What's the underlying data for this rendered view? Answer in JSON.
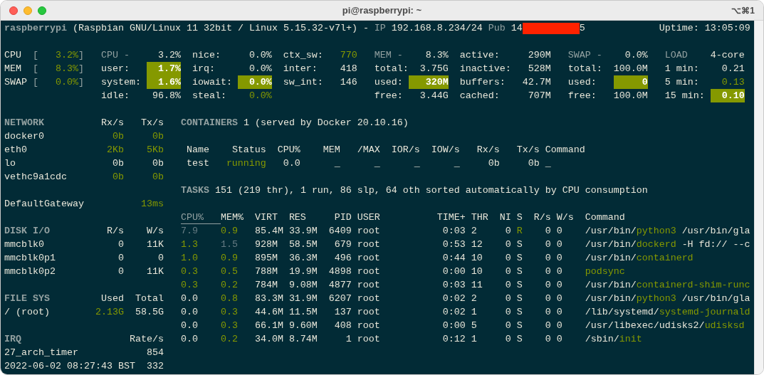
{
  "window": {
    "title": "pi@raspberrypi: ~",
    "shortcut": "⌥⌘1"
  },
  "header": {
    "hostname": "raspberrypi",
    "system": "(Raspbian GNU/Linux 11 32bit / Linux 5.15.32-v7l+)",
    "separator": "-",
    "ip_label": "IP",
    "ip": "192.168.8.234/24",
    "pub_label": "Pub",
    "pub_ip_start": "14",
    "pub_ip_end": "5",
    "uptime": "Uptime: 13:05:09"
  },
  "quicklook": [
    {
      "label": "CPU",
      "open": "[",
      "value": "3.2%",
      "close": "]"
    },
    {
      "label": "MEM",
      "open": "[",
      "value": "8.3%",
      "close": "]"
    },
    {
      "label": "SWAP",
      "open": "[",
      "value": "0.0%",
      "close": "]"
    }
  ],
  "stats": [
    {
      "kind": "cpu",
      "rows": [
        {
          "label": "CPU -",
          "value": "3.2%",
          "kind": "title"
        },
        {
          "label": "user:",
          "value": "1.7%",
          "kind": "warning"
        },
        {
          "label": "system:",
          "value": "1.6%",
          "kind": "warning"
        },
        {
          "label": "idle:",
          "value": "96.8%",
          "kind": "normal"
        }
      ]
    },
    {
      "kind": "cpu_detail",
      "rows": [
        {
          "label": "nice:",
          "value": "0.0%",
          "kind": "normal"
        },
        {
          "label": "irq:",
          "value": "0.0%",
          "kind": "normal"
        },
        {
          "label": "iowait:",
          "value": "0.0%",
          "kind": "warning"
        },
        {
          "label": "steal:",
          "value": "0.0%",
          "kind": "careful"
        }
      ]
    },
    {
      "kind": "cpu_switch",
      "rows": [
        {
          "label": "ctx_sw:",
          "value": "770",
          "kind": "careful"
        },
        {
          "label": "inter:",
          "value": "418",
          "kind": "normal"
        },
        {
          "label": "sw_int:",
          "value": "146",
          "kind": "normal"
        }
      ]
    },
    {
      "kind": "mem",
      "rows": [
        {
          "label": "MEM -",
          "value": "8.3%",
          "kind": "title"
        },
        {
          "label": "total:",
          "value": "3.75G",
          "kind": "normal"
        },
        {
          "label": "used:",
          "value": "320M",
          "kind": "warning"
        },
        {
          "label": "free:",
          "value": "3.44G",
          "kind": "normal"
        }
      ]
    },
    {
      "kind": "mem_detail",
      "rows": [
        {
          "label": "active:",
          "value": "290M",
          "kind": "normal"
        },
        {
          "label": "inactive:",
          "value": "528M",
          "kind": "normal"
        },
        {
          "label": "buffers:",
          "value": "42.7M",
          "kind": "normal"
        },
        {
          "label": "cached:",
          "value": "707M",
          "kind": "normal"
        }
      ]
    },
    {
      "kind": "swap",
      "rows": [
        {
          "label": "SWAP -",
          "value": "0.0%",
          "kind": "title"
        },
        {
          "label": "total:",
          "value": "100.0M",
          "kind": "normal"
        },
        {
          "label": "used:",
          "value": "0",
          "kind": "warning"
        },
        {
          "label": "free:",
          "value": "100.0M",
          "kind": "normal"
        }
      ]
    },
    {
      "kind": "load",
      "rows": [
        {
          "label": "LOAD",
          "value": "4-core",
          "kind": "title"
        },
        {
          "label": "1 min:",
          "value": "0.21",
          "kind": "normal"
        },
        {
          "label": "5 min:",
          "value": "0.13",
          "kind": "careful"
        },
        {
          "label": "15 min:",
          "value": "0.10",
          "kind": "warning"
        }
      ]
    }
  ],
  "sidebar": [
    {
      "header": [
        "NETWORK",
        "Rx/s",
        "Tx/s"
      ],
      "rows": [
        [
          {
            "text": "docker0",
            "kind": "normal"
          },
          {
            "text": "0b",
            "kind": "careful"
          },
          {
            "text": "0b",
            "kind": "careful"
          }
        ],
        [
          {
            "text": "eth0",
            "kind": "normal"
          },
          {
            "text": "2Kb",
            "kind": "careful"
          },
          {
            "text": "5Kb",
            "kind": "careful"
          }
        ],
        [
          {
            "text": "lo",
            "kind": "normal"
          },
          {
            "text": "0b",
            "kind": "normal"
          },
          {
            "text": "0b",
            "kind": "normal"
          }
        ],
        [
          {
            "text": "vethc9a1cdc",
            "kind": "normal"
          },
          {
            "text": "0b",
            "kind": "careful"
          },
          {
            "text": "0b",
            "kind": "careful"
          }
        ]
      ]
    },
    {
      "rows": [
        [
          {
            "text": "DefaultGateway",
            "kind": "normal"
          },
          {
            "text": "13ms",
            "kind": "careful"
          }
        ]
      ]
    },
    {
      "header": [
        "DISK I/O",
        "R/s",
        "W/s"
      ],
      "rows": [
        [
          {
            "text": "mmcblk0",
            "kind": "normal"
          },
          {
            "text": "0",
            "kind": "normal"
          },
          {
            "text": "11K",
            "kind": "normal"
          }
        ],
        [
          {
            "text": "mmcblk0p1",
            "kind": "normal"
          },
          {
            "text": "0",
            "kind": "normal"
          },
          {
            "text": "0",
            "kind": "normal"
          }
        ],
        [
          {
            "text": "mmcblk0p2",
            "kind": "normal"
          },
          {
            "text": "0",
            "kind": "normal"
          },
          {
            "text": "11K",
            "kind": "normal"
          }
        ]
      ]
    },
    {
      "header": [
        "FILE SYS",
        "Used",
        "Total"
      ],
      "rows": [
        [
          {
            "text": "/ (root)",
            "kind": "normal"
          },
          {
            "text": "2.13G",
            "kind": "careful"
          },
          {
            "text": "58.5G",
            "kind": "normal"
          }
        ]
      ]
    },
    {
      "header": [
        "IRQ",
        "Rate/s"
      ],
      "rows": [
        [
          {
            "text": "27_arch_timer",
            "kind": "normal"
          },
          {
            "text": "854",
            "kind": "normal"
          }
        ],
        [
          {
            "text": "2022-06-02 08:27:43 BST",
            "kind": "normal"
          },
          {
            "text": "332",
            "kind": "normal"
          }
        ]
      ]
    }
  ],
  "containers": {
    "title": "CONTAINERS",
    "summary": "1 (served by Docker 20.10.16)",
    "columns": [
      "Name",
      "Status",
      "CPU%",
      "MEM",
      "/MAX",
      "IOR/s",
      "IOW/s",
      "Rx/s",
      "Tx/s",
      "Command"
    ],
    "rows": [
      [
        {
          "text": "test",
          "kind": "normal"
        },
        {
          "text": "running",
          "kind": "careful"
        },
        {
          "text": "0.0",
          "kind": "normal"
        },
        {
          "text": "_",
          "kind": "normal"
        },
        {
          "text": "_",
          "kind": "normal"
        },
        {
          "text": "_",
          "kind": "normal"
        },
        {
          "text": "_",
          "kind": "normal"
        },
        {
          "text": "0b",
          "kind": "normal"
        },
        {
          "text": "0b",
          "kind": "normal"
        },
        {
          "text": "_",
          "kind": "normal"
        }
      ]
    ]
  },
  "tasks": {
    "title": "TASKS",
    "summary": "151 (219 thr), 1 run, 86 slp, 64 oth sorted automatically by CPU consumption"
  },
  "processes": {
    "columns": [
      {
        "text": "CPU%",
        "sorted": true
      },
      {
        "text": "MEM%",
        "sorted": false
      },
      {
        "text": "VIRT",
        "sorted": false
      },
      {
        "text": "RES",
        "sorted": false
      },
      {
        "text": "PID",
        "sorted": false
      },
      {
        "text": "USER",
        "sorted": false
      },
      {
        "text": "TIME+",
        "sorted": false
      },
      {
        "text": "THR",
        "sorted": false
      },
      {
        "text": "NI",
        "sorted": false
      },
      {
        "text": "S",
        "sorted": false
      },
      {
        "text": "R/s",
        "sorted": false
      },
      {
        "text": "W/s",
        "sorted": false
      },
      {
        "text": "Command",
        "sorted": false
      }
    ],
    "rows": [
      {
        "cpu": {
          "text": "7.9",
          "kind": "dim"
        },
        "mem": {
          "text": "0.9",
          "kind": "careful"
        },
        "virt": "85.4M",
        "res": "33.9M",
        "pid": "6409",
        "user": "root",
        "time": "0:03",
        "thr": "2",
        "ni": "0",
        "state": {
          "text": "R",
          "kind": "careful"
        },
        "read": "0",
        "write": "0",
        "command": {
          "path": "/usr/bin/",
          "name": "python3",
          "args": "/usr/bin/gla"
        }
      },
      {
        "cpu": {
          "text": "1.3",
          "kind": "careful"
        },
        "mem": {
          "text": "1.5",
          "kind": "dim"
        },
        "virt": "928M",
        "res": "58.5M",
        "pid": "679",
        "user": "root",
        "time": "0:53",
        "thr": "12",
        "ni": "0",
        "state": {
          "text": "S",
          "kind": "normal"
        },
        "read": "0",
        "write": "0",
        "command": {
          "path": "/usr/bin/",
          "name": "dockerd",
          "args": "-H fd:// --c"
        }
      },
      {
        "cpu": {
          "text": "1.0",
          "kind": "careful"
        },
        "mem": {
          "text": "0.9",
          "kind": "careful"
        },
        "virt": "895M",
        "res": "36.3M",
        "pid": "496",
        "user": "root",
        "time": "0:44",
        "thr": "10",
        "ni": "0",
        "state": {
          "text": "S",
          "kind": "normal"
        },
        "read": "0",
        "write": "0",
        "command": {
          "path": "/usr/bin/",
          "name": "containerd"
        }
      },
      {
        "cpu": {
          "text": "0.3",
          "kind": "careful"
        },
        "mem": {
          "text": "0.5",
          "kind": "careful"
        },
        "virt": "788M",
        "res": "19.9M",
        "pid": "4898",
        "user": "root",
        "time": "0:00",
        "thr": "10",
        "ni": "0",
        "state": {
          "text": "S",
          "kind": "normal"
        },
        "read": "0",
        "write": "0",
        "command": {
          "name": "podsync"
        }
      },
      {
        "cpu": {
          "text": "0.3",
          "kind": "careful"
        },
        "mem": {
          "text": "0.2",
          "kind": "careful"
        },
        "virt": "784M",
        "res": "9.08M",
        "pid": "4877",
        "user": "root",
        "time": "0:03",
        "thr": "11",
        "ni": "0",
        "state": {
          "text": "S",
          "kind": "normal"
        },
        "read": "0",
        "write": "0",
        "command": {
          "path": "/usr/bin/",
          "name": "containerd-shim-runc"
        }
      },
      {
        "cpu": {
          "text": "0.0",
          "kind": "normal"
        },
        "mem": {
          "text": "0.8",
          "kind": "careful"
        },
        "virt": "83.3M",
        "res": "31.9M",
        "pid": "6207",
        "user": "root",
        "time": "0:02",
        "thr": "2",
        "ni": "0",
        "state": {
          "text": "S",
          "kind": "normal"
        },
        "read": "0",
        "write": "0",
        "command": {
          "path": "/usr/bin/",
          "name": "python3",
          "args": "/usr/bin/gla"
        }
      },
      {
        "cpu": {
          "text": "0.0",
          "kind": "normal"
        },
        "mem": {
          "text": "0.3",
          "kind": "careful"
        },
        "virt": "44.6M",
        "res": "11.5M",
        "pid": "137",
        "user": "root",
        "time": "0:02",
        "thr": "1",
        "ni": "0",
        "state": {
          "text": "S",
          "kind": "normal"
        },
        "read": "0",
        "write": "0",
        "command": {
          "path": "/lib/systemd/",
          "name": "systemd-journald"
        }
      },
      {
        "cpu": {
          "text": "0.0",
          "kind": "normal"
        },
        "mem": {
          "text": "0.3",
          "kind": "careful"
        },
        "virt": "66.1M",
        "res": "9.60M",
        "pid": "408",
        "user": "root",
        "time": "0:00",
        "thr": "5",
        "ni": "0",
        "state": {
          "text": "S",
          "kind": "normal"
        },
        "read": "0",
        "write": "0",
        "command": {
          "path": "/usr/libexec/udisks2/",
          "name": "udisksd"
        }
      },
      {
        "cpu": {
          "text": "0.0",
          "kind": "normal"
        },
        "mem": {
          "text": "0.2",
          "kind": "careful"
        },
        "virt": "34.0M",
        "res": "8.74M",
        "pid": "1",
        "user": "root",
        "time": "0:12",
        "thr": "1",
        "ni": "0",
        "state": {
          "text": "S",
          "kind": "normal"
        },
        "read": "0",
        "write": "0",
        "command": {
          "path": "/sbin/",
          "name": "init"
        }
      }
    ]
  }
}
